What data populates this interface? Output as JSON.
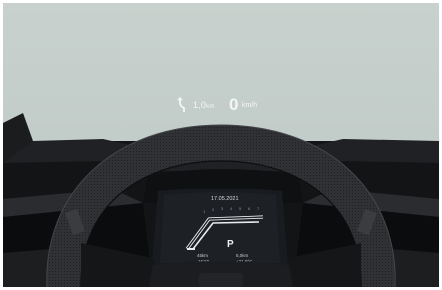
{
  "hud": {
    "turn_icon": "slight-left-turn-arrow-icon",
    "distance": "1,0",
    "distance_unit": "km",
    "speed": "0",
    "speed_unit": "km/h"
  },
  "cluster": {
    "date": "17.05.2021",
    "gear": "P",
    "left_line1": "45",
    "left_line1_unit": "km",
    "left_line2": "16:59",
    "right_line1": "5,0",
    "right_line1_unit": "km",
    "right_line2": "+21,0",
    "right_line2_unit": "°C",
    "tachometer_marks": [
      "1",
      "2",
      "3",
      "4",
      "5",
      "6",
      "7"
    ]
  },
  "colors": {
    "windshield": "#c6cfcb",
    "hud_text": "#f4f6f5",
    "dashboard": "#101113",
    "cluster_bg": "#1a1d21",
    "graphic": "#e9ecee"
  }
}
